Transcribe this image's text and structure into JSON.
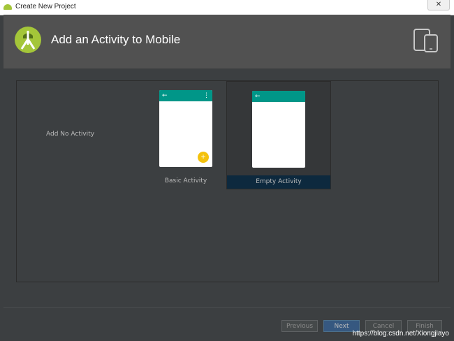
{
  "window": {
    "title": "Create New Project",
    "close_label": "✕"
  },
  "header": {
    "title": "Add an Activity to Mobile"
  },
  "gallery": {
    "no_activity_label": "Add No Activity",
    "tiles": [
      {
        "label": "Basic Activity",
        "selected": false,
        "has_fab": true,
        "has_menu": true
      },
      {
        "label": "Empty Activity",
        "selected": true,
        "has_fab": false,
        "has_menu": false
      }
    ],
    "phone_glyphs": {
      "back": "←",
      "menu": "⋮",
      "fab": "+"
    }
  },
  "footer": {
    "previous_label": "Previous",
    "next_label": "Next",
    "cancel_label": "Cancel",
    "finish_label": "Finish"
  },
  "watermark": "https://blog.csdn.net/Xiongjiayo",
  "colors": {
    "appbar": "#009688",
    "fab": "#f4c20d",
    "selection": "#0d293e",
    "primary_button": "#365880",
    "android_green": "#a4c639"
  }
}
